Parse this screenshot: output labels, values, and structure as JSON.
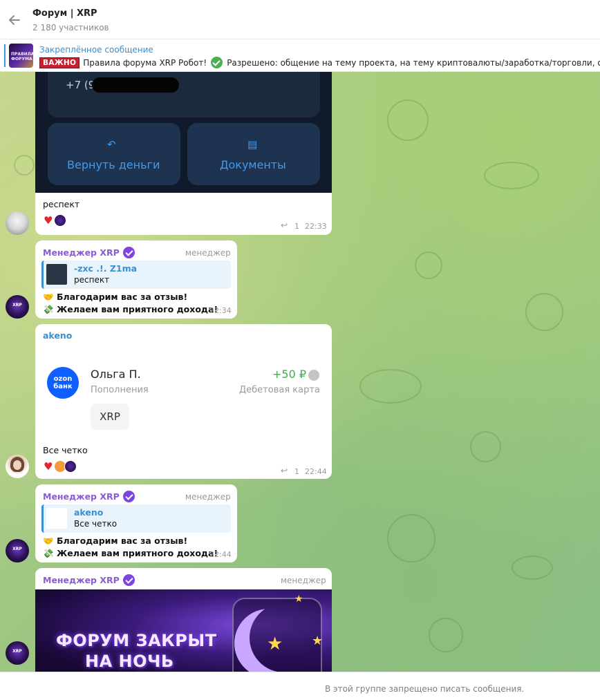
{
  "header": {
    "title": "Форум | XRP",
    "members": "2 180 участников"
  },
  "pinned": {
    "title": "Закреплённое сообщение",
    "badge": "ВАЖНО",
    "text_start": "Правила форума XRP Робот!",
    "text_end": "Разрешено: общение на тему проекта, на тему криптовалюты/заработка/торговли, об",
    "thumb_text": "ПРАВИЛА ФОРУМА"
  },
  "messages": [
    {
      "id": "m1",
      "card": {
        "phone": "+7 (9",
        "btn_refund": "Вернуть деньги",
        "btn_docs": "Документы"
      },
      "text": "респект",
      "reply_count": "1",
      "time": "22:33"
    },
    {
      "id": "m2",
      "sender": "Менеджер XRP",
      "role": "менеджер",
      "quote_name": "-zxc .!. Z1ma",
      "quote_text": "респект",
      "line1": "Благодарим вас за отзыв!",
      "line2": "Желаем вам приятного дохода!",
      "time": "22:34"
    },
    {
      "id": "m3",
      "sender": "akeno",
      "card": {
        "bank_logo": "ozon банк",
        "name": "Ольга П.",
        "category": "Пополнения",
        "amount": "+50 ₽",
        "account": "Дебетовая карта",
        "chip": "XRP"
      },
      "text": "Все четко",
      "reply_count": "1",
      "time": "22:44"
    },
    {
      "id": "m4",
      "sender": "Менеджер XRP",
      "role": "менеджер",
      "quote_name": "akeno",
      "quote_text": "Все четко",
      "line1": "Благодарим вас за отзыв!",
      "line2": "Желаем вам приятного дохода!",
      "time": "22:44"
    },
    {
      "id": "m5",
      "sender": "Менеджер XRP",
      "role": "менеджер",
      "banner_line1": "ФОРУМ ЗАКРЫТ",
      "banner_line2": "НА НОЧЬ"
    }
  ],
  "footer": {
    "text": "В этой группе запрещено писать сообщения."
  },
  "icons": {
    "back": "arrow-left-icon",
    "check": "green-check-icon",
    "verified": "verified-badge-icon",
    "heart": "heart-icon",
    "reply": "reply-arrow-icon",
    "money_bag": "money-icon",
    "handshake": "handshake-icon"
  },
  "colors": {
    "accent": "#3a8fd0",
    "manager_name": "#8b5bd6",
    "verified": "#7c45e0",
    "amount": "#3cae4a",
    "badge_red": "#c91f2e"
  }
}
